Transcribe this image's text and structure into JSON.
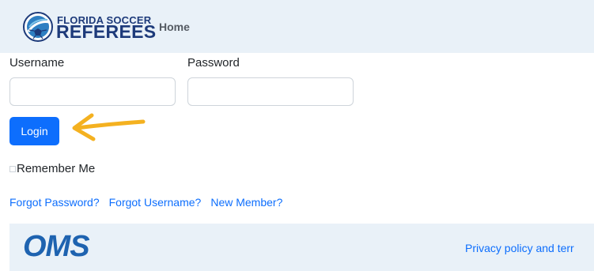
{
  "header": {
    "logo_line1": "FLORIDA SOCCER",
    "logo_line2": "REFEREES",
    "home_label": "Home"
  },
  "form": {
    "username_label": "Username",
    "password_label": "Password",
    "username_value": "",
    "password_value": "",
    "login_label": "Login",
    "remember_label": "Remember Me",
    "remember_checked": false
  },
  "links": {
    "forgot_password": "Forgot Password?",
    "forgot_username": "Forgot Username?",
    "new_member": "New Member?"
  },
  "footer": {
    "oms_logo": "OMS",
    "privacy_text": "Privacy policy and terr"
  },
  "colors": {
    "primary": "#0d6efd",
    "header_bg": "#e9f1f8",
    "logo_navy": "#1d3a7a",
    "annotation_arrow": "#f4b120"
  },
  "icons": {
    "logo_mark": "soccer-ball-icon",
    "annotation": "arrow-pointing-left-icon"
  }
}
